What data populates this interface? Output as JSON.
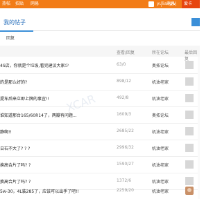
{
  "topbar": {
    "nav_items": [
      "热帖",
      "招贴",
      "网易"
    ],
    "username": "yuliangwj",
    "notices_label": "消息",
    "brand_label": "爱卡"
  },
  "tabs": {
    "mine_label": "我的帖子"
  },
  "subnav": {
    "label": "回复"
  },
  "table": {
    "headers": {
      "views": "查看/回复",
      "forum": "所在论坛",
      "last": "最后回复"
    },
    "rows": [
      {
        "title": "4S店，你就是个垃圾,看完建议大家少",
        "stats": "63/0",
        "forum": "奥拓论坛"
      },
      {
        "title": "的是那么好的?",
        "stats": "898/12",
        "forum": "机油老家"
      },
      {
        "title": "提车后来立即上牌的事宜!!",
        "stats": "492/8",
        "forum": "机油老家"
      },
      {
        "title": "谁知道那台165/60R14了，两瓣有问题...",
        "stats": "1609/3",
        "forum": "奥拓论坛"
      },
      {
        "title": "静啊!!",
        "stats": "2685/22",
        "forum": "机油老家"
      },
      {
        "title": "日石不大了? ? ?",
        "stats": "2996/32",
        "forum": "机油老家"
      },
      {
        "title": "换高合片了吗? ?",
        "stats": "1590/27",
        "forum": "机油老家"
      },
      {
        "title": "换高合片了吗? ?",
        "stats": "1372/6",
        "forum": "机油老家"
      },
      {
        "title": "5w-30，4L装285了，应该可以出手了吧!!",
        "stats": "2259/20",
        "forum": "机油老家"
      }
    ]
  },
  "watermark_text": "XCAR"
}
